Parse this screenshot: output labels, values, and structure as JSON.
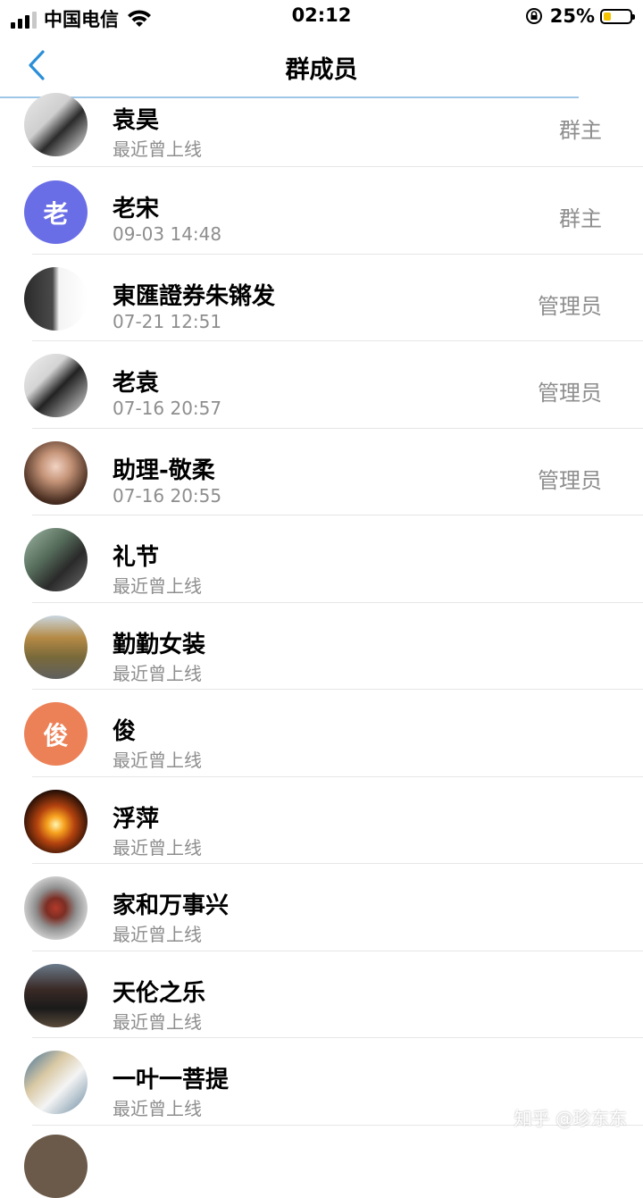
{
  "status_bar": {
    "carrier": "中国电信",
    "time": "02:12",
    "battery_percent": "25%",
    "battery_level": 0.25,
    "battery_color": "#f5c400",
    "icons": [
      "signal-icon",
      "wifi-icon",
      "orientation-lock-icon",
      "battery-icon"
    ]
  },
  "nav": {
    "title": "群成员",
    "back_icon": "chevron-left-icon",
    "accent": "#2a8fd8"
  },
  "members": [
    {
      "name": "袁昊",
      "sub": "最近曾上线",
      "role": "群主",
      "avatar": "photo"
    },
    {
      "name": "老宋",
      "sub": "09-03 14:48",
      "role": "群主",
      "avatar": "letter",
      "letter": "老",
      "color": "#6a6ee6"
    },
    {
      "name": "東匯證券朱锵发",
      "sub": "07-21 12:51",
      "role": "管理员",
      "avatar": "photo"
    },
    {
      "name": "老袁",
      "sub": "07-16 20:57",
      "role": "管理员",
      "avatar": "photo"
    },
    {
      "name": "助理-敬柔",
      "sub": "07-16 20:55",
      "role": "管理员",
      "avatar": "photo"
    },
    {
      "name": "礼节",
      "sub": "最近曾上线",
      "role": "",
      "avatar": "photo"
    },
    {
      "name": "勤勤女装",
      "sub": "最近曾上线",
      "role": "",
      "avatar": "photo"
    },
    {
      "name": "俊",
      "sub": "最近曾上线",
      "role": "",
      "avatar": "letter",
      "letter": "俊",
      "color": "#ec8158"
    },
    {
      "name": "浮萍",
      "sub": "最近曾上线",
      "role": "",
      "avatar": "photo"
    },
    {
      "name": "家和万事兴",
      "sub": "最近曾上线",
      "role": "",
      "avatar": "photo"
    },
    {
      "name": "天伦之乐",
      "sub": "最近曾上线",
      "role": "",
      "avatar": "photo"
    },
    {
      "name": "一叶一菩提",
      "sub": "最近曾上线",
      "role": "",
      "avatar": "photo"
    }
  ],
  "watermark": "知乎 @珍东东"
}
